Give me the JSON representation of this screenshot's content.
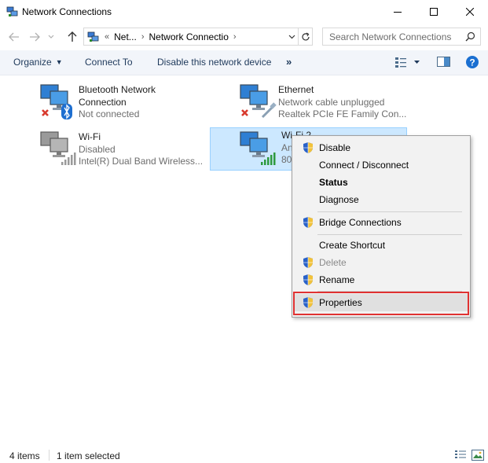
{
  "window": {
    "title": "Network Connections"
  },
  "address": {
    "overflow": "«",
    "crumbs": [
      "Net...",
      "Network Connectio"
    ]
  },
  "search": {
    "placeholder": "Search Network Connections"
  },
  "toolbar": {
    "organize": "Organize",
    "connect_to": "Connect To",
    "disable_device": "Disable this network device",
    "more": "»"
  },
  "items": [
    {
      "name": "Bluetooth Network",
      "name2": "Connection",
      "status": "Not connected",
      "icon": "bluetooth-network-icon"
    },
    {
      "name": "Ethernet",
      "status": "Network cable unplugged",
      "device": "Realtek PCIe FE Family Con...",
      "icon": "ethernet-icon"
    },
    {
      "name": "Wi-Fi",
      "status": "Disabled",
      "device": "Intel(R) Dual Band Wireless...",
      "icon": "wifi-icon"
    },
    {
      "name": "Wi-Fi 2",
      "status": "An",
      "device": "80",
      "icon": "wifi-icon"
    }
  ],
  "context_menu": {
    "items": [
      {
        "label": "Disable",
        "shield": true
      },
      {
        "label": "Connect / Disconnect",
        "shield": false
      },
      {
        "label": "Status",
        "shield": false,
        "bold": true
      },
      {
        "label": "Diagnose",
        "shield": false
      },
      {
        "label": "Bridge Connections",
        "shield": true
      },
      {
        "label": "Create Shortcut",
        "shield": false
      },
      {
        "label": "Delete",
        "shield": true,
        "disabled": true
      },
      {
        "label": "Rename",
        "shield": true
      },
      {
        "label": "Properties",
        "shield": true,
        "highlighted": true
      }
    ]
  },
  "status_bar": {
    "count": "4 items",
    "selected": "1 item selected"
  },
  "colors": {
    "accent": "#0078d7",
    "selection": "#cce8ff",
    "highlight_box": "#e03232"
  }
}
